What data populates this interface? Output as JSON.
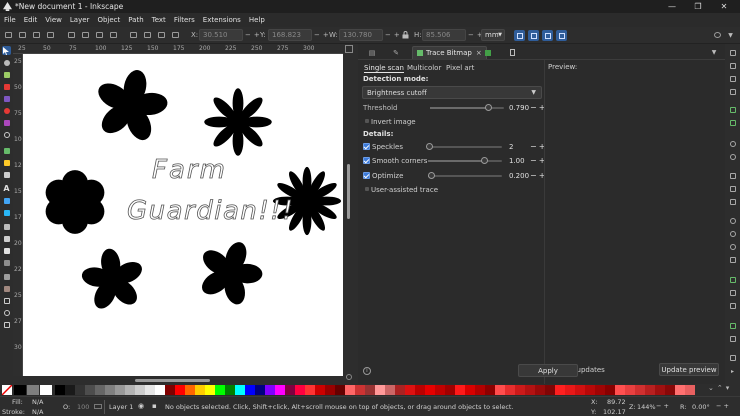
{
  "window": {
    "title": "*New document 1 - Inkscape",
    "controls": [
      "—",
      "❐",
      "✕"
    ]
  },
  "menubar": [
    "File",
    "Edit",
    "View",
    "Layer",
    "Object",
    "Path",
    "Text",
    "Filters",
    "Extensions",
    "Help"
  ],
  "controls_bar": {
    "x": {
      "label": "X:",
      "value": "30.510"
    },
    "y": {
      "label": "Y:",
      "value": "168.823"
    },
    "w": {
      "label": "W:",
      "value": "130.780"
    },
    "h": {
      "label": "H:",
      "value": "85.506"
    },
    "unit": "mm"
  },
  "rulers": {
    "h": [
      "25",
      "50",
      "75",
      "100",
      "125",
      "150",
      "175",
      "200",
      "225",
      "250",
      "275",
      "300"
    ],
    "v": [
      "25",
      "50",
      "75",
      "100",
      "125",
      "150",
      "175",
      "200",
      "225",
      "250",
      "275",
      "300"
    ]
  },
  "canvas": {
    "text_line1": "Farm",
    "text_line2": "Guardian!!!"
  },
  "trace_panel": {
    "tab_label": "Trace Bitmap",
    "tab_close": "×",
    "subtabs": [
      "Single scan",
      "Multicolor",
      "Pixel art"
    ],
    "detection_mode_label": "Detection mode:",
    "detection_mode_value": "Brightness cutoff",
    "threshold_label": "Threshold",
    "threshold_value": "0.790",
    "threshold_level": 0.79,
    "invert_label": "Invert image",
    "details_label": "Details:",
    "speckles_label": "Speckles",
    "speckles_value": "2",
    "speckles_level": 0.02,
    "smooth_label": "Smooth corners",
    "smooth_value": "1.00",
    "smooth_level": 0.75,
    "optimize_label": "Optimize",
    "optimize_value": "0.200",
    "optimize_level": 0.04,
    "assisted_label": "User-assisted trace",
    "preview_label": "Preview:",
    "live_updates_label": "Live updates",
    "update_preview_label": "Update preview",
    "apply_label": "Apply",
    "plus": "+",
    "minus": "−"
  },
  "status": {
    "fill_label": "Fill:",
    "fill_value": "N/A",
    "stroke_label": "Stroke:",
    "stroke_value": "N/A",
    "opacity_label": "O:",
    "opacity_value": "100",
    "layer": "Layer 1",
    "message": "No objects selected. Click, Shift+click, Alt+scroll mouse on top of objects, or drag around objects to select.",
    "x_label": "X:",
    "x_value": "89.72",
    "y_label": "Y:",
    "y_value": "102.17",
    "z_label": "Z:",
    "z_value": "144%",
    "r_label": "R:",
    "r_value": "0.00°"
  },
  "colors": {
    "accent": "#3d7bd9",
    "palette": [
      "#000000",
      "#1a1a1a",
      "#333333",
      "#4d4d4d",
      "#666666",
      "#808080",
      "#999999",
      "#b3b3b3",
      "#cccccc",
      "#e6e6e6",
      "#ffffff",
      "#800000",
      "#ff0000",
      "#ff6600",
      "#ffcc00",
      "#ffff00",
      "#00ff00",
      "#008000",
      "#00ffff",
      "#0000ff",
      "#000080",
      "#8000ff",
      "#ff00ff",
      "#800040",
      "#ff0040",
      "#ff3333",
      "#cc0000",
      "#990000",
      "#660000",
      "#ff6666",
      "#cc3333",
      "#993333",
      "#ff9999",
      "#cc6666",
      "#aa2222",
      "#dd1111",
      "#bb0000",
      "#e60000",
      "#c00000",
      "#a00000",
      "#ff1a1a",
      "#d90000",
      "#b30000",
      "#8c0000",
      "#ff4d4d",
      "#e62e2e",
      "#cc1a1a",
      "#b31212",
      "#990a0a",
      "#800505",
      "#ff2020",
      "#e81818",
      "#d01010",
      "#b80808",
      "#a00404",
      "#880000",
      "#ff5050",
      "#e84040",
      "#d03030",
      "#b82020",
      "#a01010",
      "#880808",
      "#ff7070",
      "#e86060"
    ]
  },
  "icons": {
    "app": "inkscape-icon",
    "tools": [
      "selector-icon",
      "node-icon",
      "tweak-icon",
      "zoom-icon",
      "rect-icon",
      "3dbox-icon",
      "ellipse-icon",
      "star-icon",
      "spiral-icon",
      "pencil-icon",
      "pen-icon",
      "calligraphy-icon",
      "text-icon",
      "spray-icon",
      "eraser-icon",
      "bucket-icon",
      "gradient-icon",
      "mesh-icon",
      "dropper-icon",
      "connector-icon",
      "measure-icon",
      "lpe-icon",
      "page-icon"
    ]
  }
}
